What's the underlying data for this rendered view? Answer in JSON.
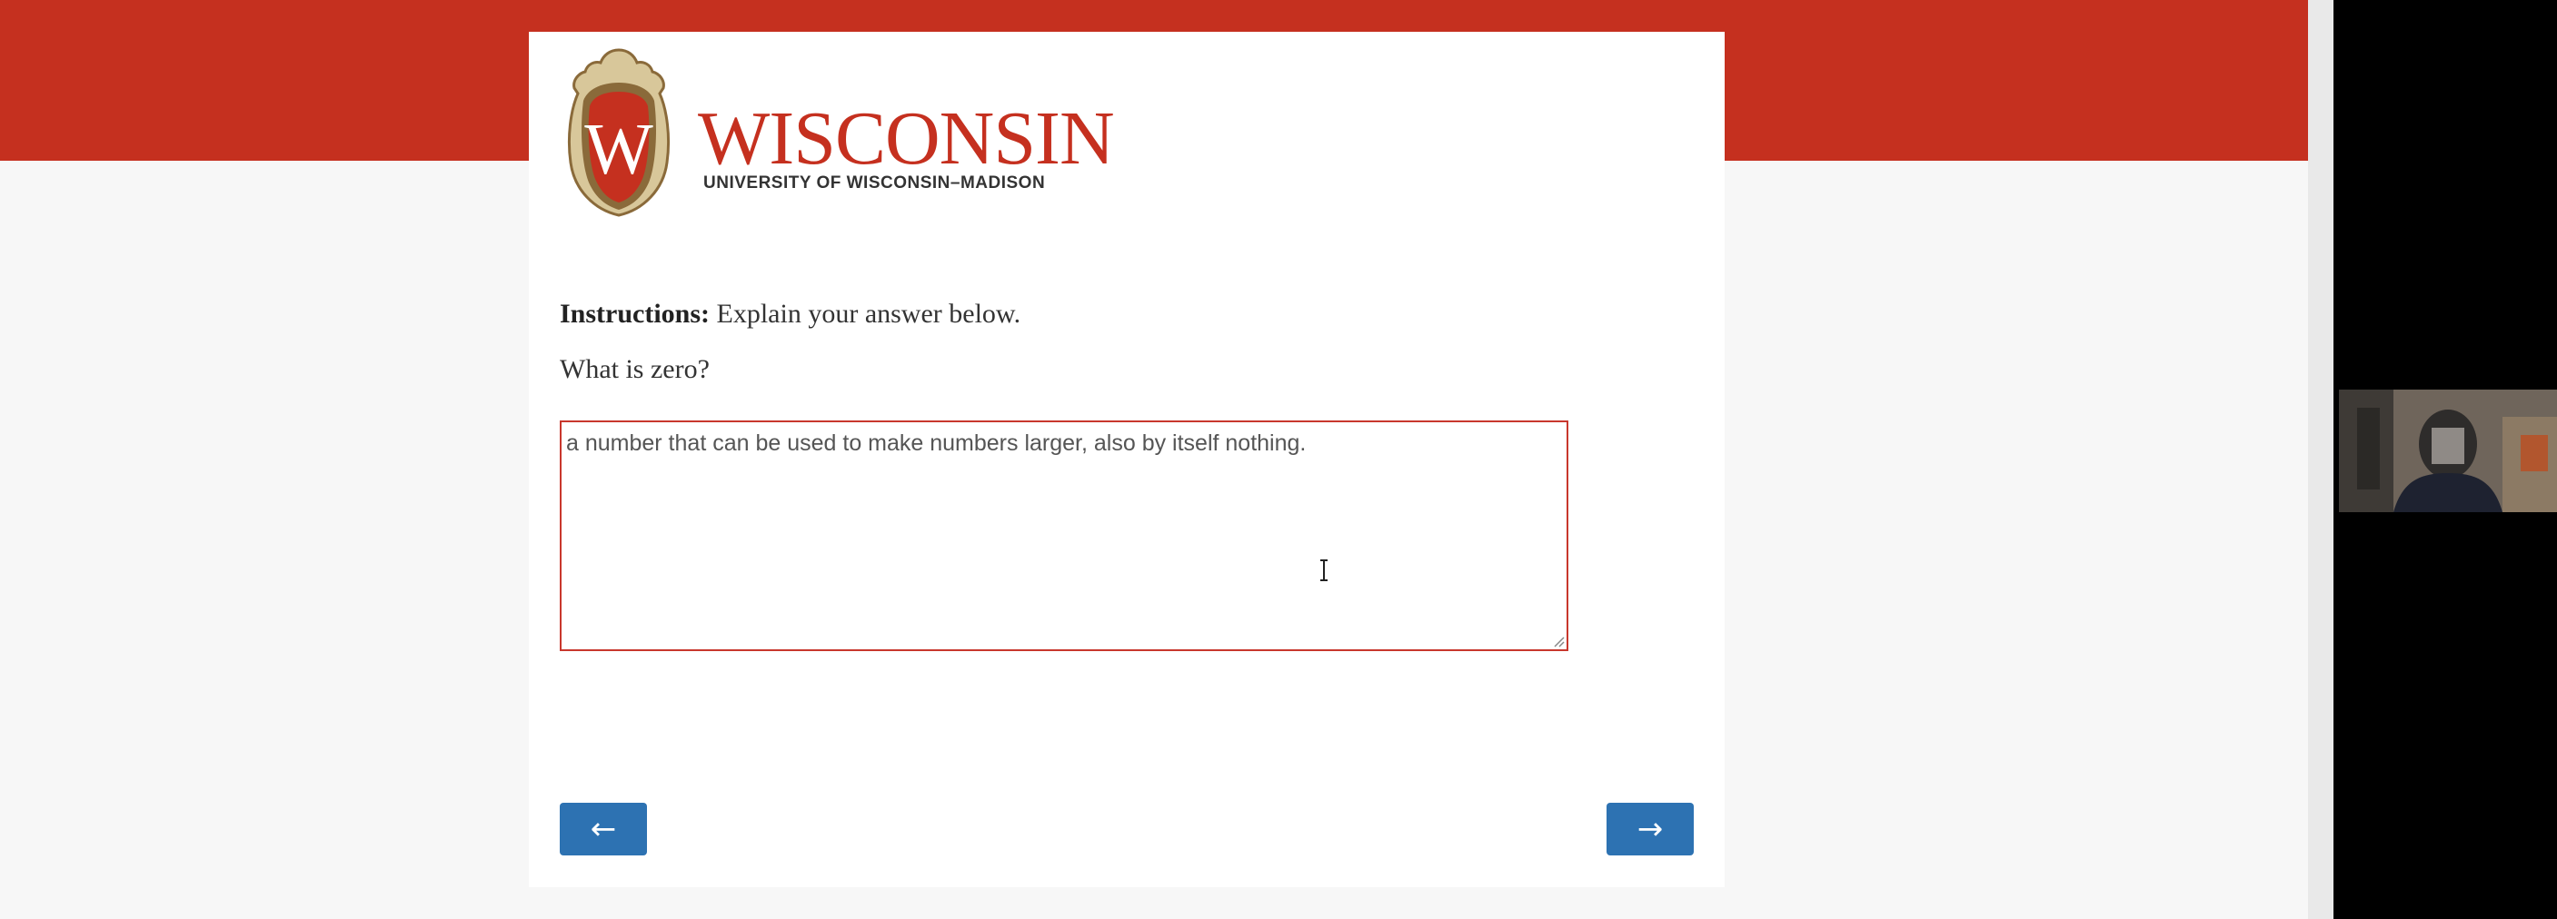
{
  "colors": {
    "brand_red": "#c5301f",
    "logo_text_red": "#c5301f",
    "logo_sub_text": "#333333",
    "button_blue": "#2d72b2",
    "answer_border": "#c8372d"
  },
  "logo": {
    "wordmark": "WISCONSIN",
    "subtitle": "UNIVERSITY OF WISCONSIN–MADISON",
    "crest_letter": "W"
  },
  "survey": {
    "instructions_label": "Instructions:",
    "instructions_text": " Explain your answer below.",
    "question": "What is zero?",
    "answer_value": "a number that can be used to make numbers larger, also by itself nothing."
  },
  "navigation": {
    "back_label": "←",
    "next_label": "→"
  },
  "icons": {
    "text_cursor": "i-beam-cursor-icon",
    "resize_grip": "resize-grip-icon",
    "back": "left-arrow-icon",
    "next": "right-arrow-icon"
  }
}
